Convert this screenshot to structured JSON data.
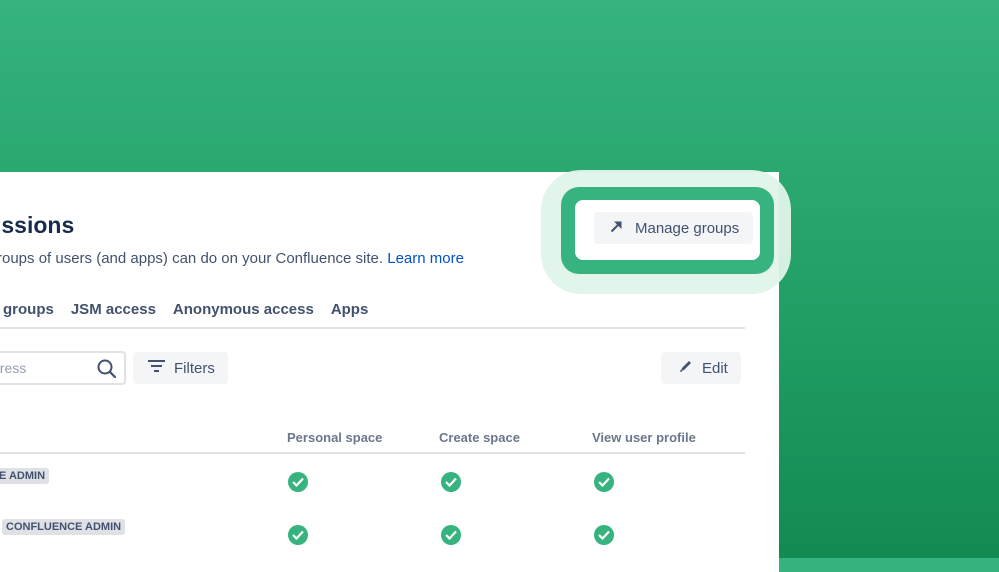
{
  "header": {
    "title_fragment": "issions",
    "description_fragment": "roups of users (and apps) can do on your Confluence site.",
    "learn_more": "Learn more",
    "manage_groups_label": "Manage groups"
  },
  "tabs": [
    {
      "label": "groups"
    },
    {
      "label": "JSM access"
    },
    {
      "label": "Anonymous access"
    },
    {
      "label": "Apps"
    }
  ],
  "toolbar": {
    "search_placeholder_fragment": "dress",
    "filters_label": "Filters",
    "edit_label": "Edit"
  },
  "table": {
    "columns": [
      "Personal space",
      "Create space",
      "View user profile"
    ],
    "rows": [
      {
        "badge": "E ADMIN",
        "personal_space": true,
        "create_space": true,
        "view_user_profile": true
      },
      {
        "badge": "CONFLUENCE ADMIN",
        "personal_space": true,
        "create_space": true,
        "view_user_profile": true
      }
    ]
  },
  "icons": {
    "manage": "arrow-up-right-icon",
    "search": "search-icon",
    "filters": "filter-lines-icon",
    "edit": "pencil-icon",
    "check": "check-circle-icon"
  },
  "colors": {
    "background_green": "#36b37e",
    "check_green": "#36b37e",
    "link_blue": "#0052cc",
    "heading": "#172b4d"
  }
}
